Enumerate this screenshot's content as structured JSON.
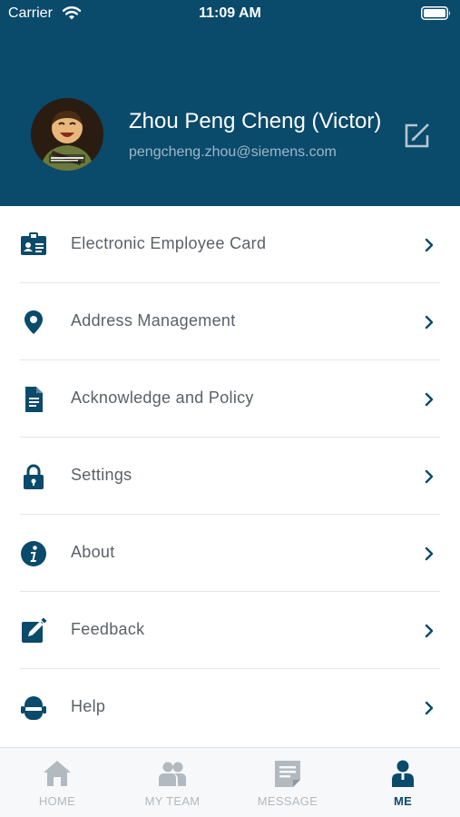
{
  "status_bar": {
    "carrier": "Carrier",
    "time": "11:09 AM"
  },
  "profile": {
    "name": "Zhou Peng Cheng (Victor)",
    "email": "pengcheng.zhou@siemens.com"
  },
  "menu": [
    {
      "label": "Electronic Employee Card",
      "icon": "id-card-icon"
    },
    {
      "label": "Address Management",
      "icon": "location-pin-icon"
    },
    {
      "label": "Acknowledge and Policy",
      "icon": "document-icon"
    },
    {
      "label": "Settings",
      "icon": "lock-icon"
    },
    {
      "label": "About",
      "icon": "info-icon"
    },
    {
      "label": "Feedback",
      "icon": "edit-icon"
    },
    {
      "label": "Help",
      "icon": "robot-icon"
    }
  ],
  "tabs": [
    {
      "label": "HOME",
      "icon": "home-icon",
      "active": false
    },
    {
      "label": "MY TEAM",
      "icon": "team-icon",
      "active": false
    },
    {
      "label": "MESSAGE",
      "icon": "message-icon",
      "active": false
    },
    {
      "label": "ME",
      "icon": "person-icon",
      "active": true
    }
  ],
  "colors": {
    "brand": "#0a4a6b",
    "inactive_tab": "#b2b9bf",
    "menu_text": "#5a6168"
  }
}
